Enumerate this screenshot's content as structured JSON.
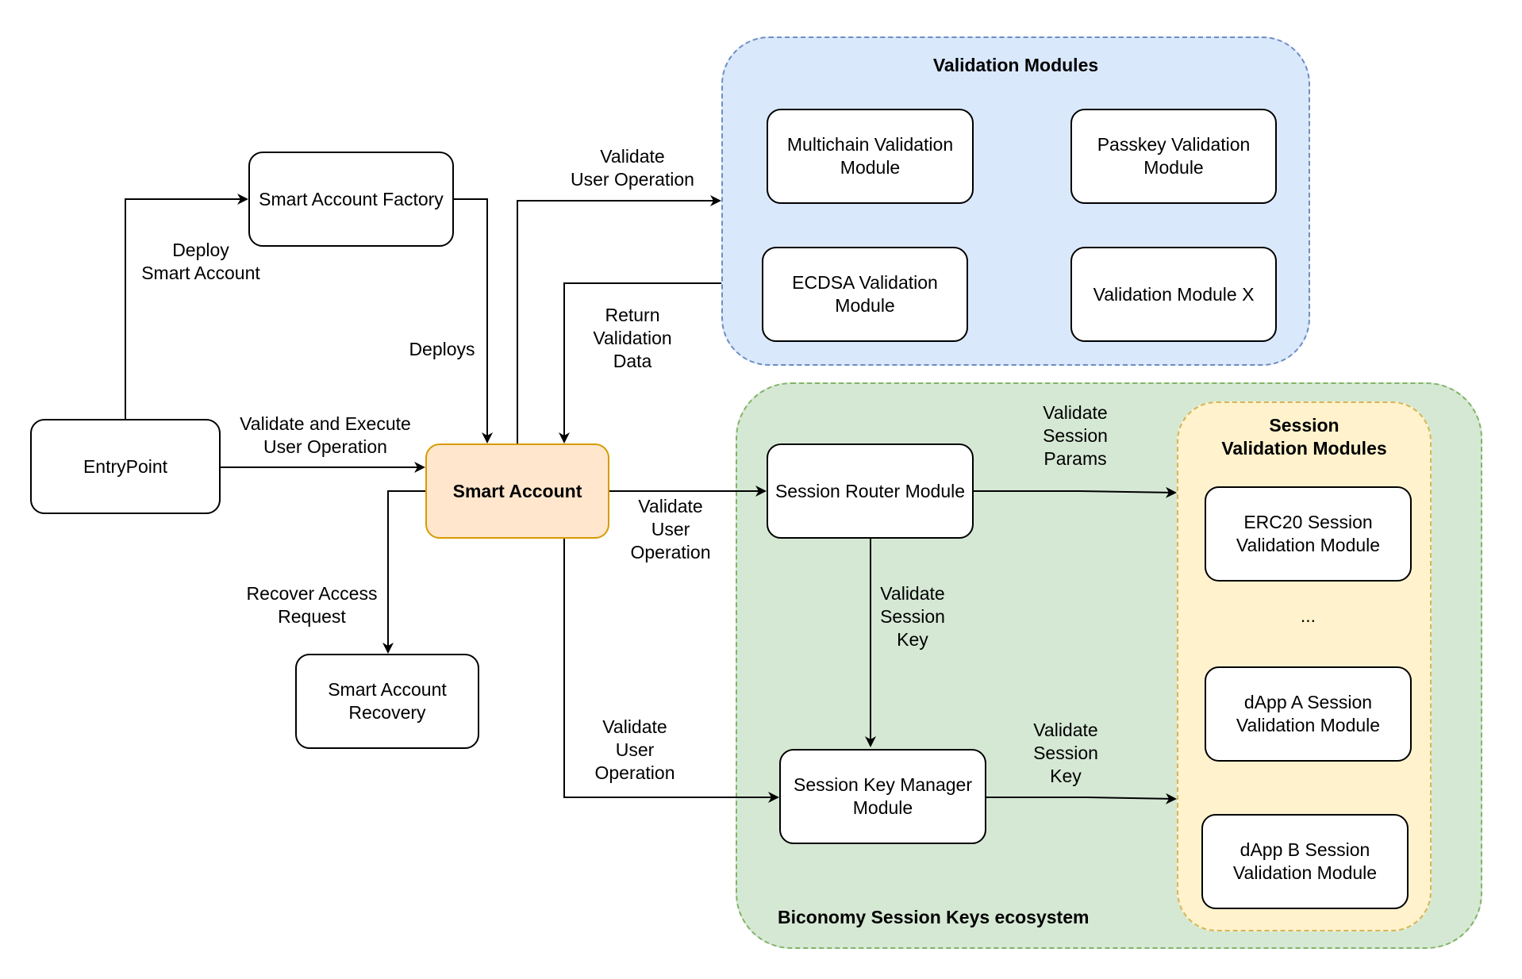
{
  "groups": {
    "validation_modules": {
      "title": "Validation Modules"
    },
    "session_ecosystem": {
      "title": "Biconomy Session Keys ecosystem"
    },
    "session_validation_modules": {
      "title": "Session\nValidation Modules"
    }
  },
  "nodes": {
    "entrypoint": "EntryPoint",
    "factory": "Smart Account Factory",
    "smart_account": "Smart Account",
    "recovery": "Smart Account\nRecovery",
    "multichain": "Multichain Validation\nModule",
    "passkey": "Passkey Validation\nModule",
    "ecdsa": "ECDSA Validation\nModule",
    "module_x": "Validation Module X",
    "session_router": "Session Router Module",
    "session_key_manager": "Session Key Manager\nModule",
    "erc20_session": "ERC20 Session\nValidation Module",
    "ellipsis": "...",
    "dapp_a_session": "dApp A Session\nValidation Module",
    "dapp_b_session": "dApp B Session\nValidation Module"
  },
  "edges": {
    "deploy_smart_account": "Deploy\nSmart Account",
    "deploys": "Deploys",
    "validate_and_execute": "Validate and Execute\nUser Operation",
    "validate_user_op_top": "Validate\nUser Operation",
    "return_validation_data": "Return\nValidation\nData",
    "validate_user_op_router": "Validate\nUser\nOperation",
    "validate_user_op_manager": "Validate\nUser\nOperation",
    "recover_access": "Recover Access\nRequest",
    "validate_session_params": "Validate\nSession\nParams",
    "validate_session_key_down": "Validate\nSession\nKey",
    "validate_session_key_right": "Validate\nSession\nKey"
  },
  "colors": {
    "blue_fill": "#dae8fc",
    "blue_stroke": "#6c8ebf",
    "green_fill": "#d5e8d4",
    "green_stroke": "#82b366",
    "yellow_fill": "#fff2cc",
    "yellow_stroke": "#d6b656",
    "orange_fill": "#ffe6cc",
    "orange_stroke": "#d79b00"
  }
}
